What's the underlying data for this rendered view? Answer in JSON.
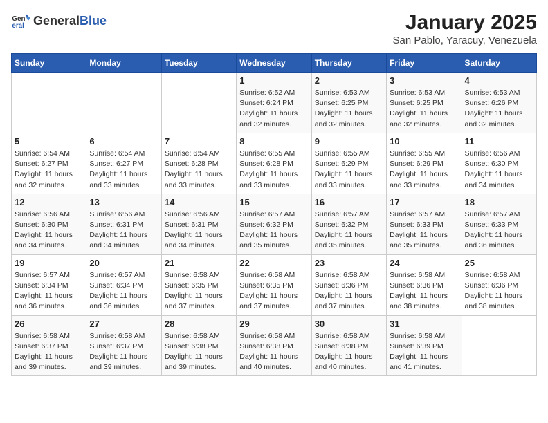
{
  "header": {
    "logo_general": "General",
    "logo_blue": "Blue",
    "title": "January 2025",
    "subtitle": "San Pablo, Yaracuy, Venezuela"
  },
  "days_of_week": [
    "Sunday",
    "Monday",
    "Tuesday",
    "Wednesday",
    "Thursday",
    "Friday",
    "Saturday"
  ],
  "weeks": [
    [
      {
        "day": "",
        "sunrise": "",
        "sunset": "",
        "daylight": ""
      },
      {
        "day": "",
        "sunrise": "",
        "sunset": "",
        "daylight": ""
      },
      {
        "day": "",
        "sunrise": "",
        "sunset": "",
        "daylight": ""
      },
      {
        "day": "1",
        "sunrise": "Sunrise: 6:52 AM",
        "sunset": "Sunset: 6:24 PM",
        "daylight": "Daylight: 11 hours and 32 minutes."
      },
      {
        "day": "2",
        "sunrise": "Sunrise: 6:53 AM",
        "sunset": "Sunset: 6:25 PM",
        "daylight": "Daylight: 11 hours and 32 minutes."
      },
      {
        "day": "3",
        "sunrise": "Sunrise: 6:53 AM",
        "sunset": "Sunset: 6:25 PM",
        "daylight": "Daylight: 11 hours and 32 minutes."
      },
      {
        "day": "4",
        "sunrise": "Sunrise: 6:53 AM",
        "sunset": "Sunset: 6:26 PM",
        "daylight": "Daylight: 11 hours and 32 minutes."
      }
    ],
    [
      {
        "day": "5",
        "sunrise": "Sunrise: 6:54 AM",
        "sunset": "Sunset: 6:27 PM",
        "daylight": "Daylight: 11 hours and 32 minutes."
      },
      {
        "day": "6",
        "sunrise": "Sunrise: 6:54 AM",
        "sunset": "Sunset: 6:27 PM",
        "daylight": "Daylight: 11 hours and 33 minutes."
      },
      {
        "day": "7",
        "sunrise": "Sunrise: 6:54 AM",
        "sunset": "Sunset: 6:28 PM",
        "daylight": "Daylight: 11 hours and 33 minutes."
      },
      {
        "day": "8",
        "sunrise": "Sunrise: 6:55 AM",
        "sunset": "Sunset: 6:28 PM",
        "daylight": "Daylight: 11 hours and 33 minutes."
      },
      {
        "day": "9",
        "sunrise": "Sunrise: 6:55 AM",
        "sunset": "Sunset: 6:29 PM",
        "daylight": "Daylight: 11 hours and 33 minutes."
      },
      {
        "day": "10",
        "sunrise": "Sunrise: 6:55 AM",
        "sunset": "Sunset: 6:29 PM",
        "daylight": "Daylight: 11 hours and 33 minutes."
      },
      {
        "day": "11",
        "sunrise": "Sunrise: 6:56 AM",
        "sunset": "Sunset: 6:30 PM",
        "daylight": "Daylight: 11 hours and 34 minutes."
      }
    ],
    [
      {
        "day": "12",
        "sunrise": "Sunrise: 6:56 AM",
        "sunset": "Sunset: 6:30 PM",
        "daylight": "Daylight: 11 hours and 34 minutes."
      },
      {
        "day": "13",
        "sunrise": "Sunrise: 6:56 AM",
        "sunset": "Sunset: 6:31 PM",
        "daylight": "Daylight: 11 hours and 34 minutes."
      },
      {
        "day": "14",
        "sunrise": "Sunrise: 6:56 AM",
        "sunset": "Sunset: 6:31 PM",
        "daylight": "Daylight: 11 hours and 34 minutes."
      },
      {
        "day": "15",
        "sunrise": "Sunrise: 6:57 AM",
        "sunset": "Sunset: 6:32 PM",
        "daylight": "Daylight: 11 hours and 35 minutes."
      },
      {
        "day": "16",
        "sunrise": "Sunrise: 6:57 AM",
        "sunset": "Sunset: 6:32 PM",
        "daylight": "Daylight: 11 hours and 35 minutes."
      },
      {
        "day": "17",
        "sunrise": "Sunrise: 6:57 AM",
        "sunset": "Sunset: 6:33 PM",
        "daylight": "Daylight: 11 hours and 35 minutes."
      },
      {
        "day": "18",
        "sunrise": "Sunrise: 6:57 AM",
        "sunset": "Sunset: 6:33 PM",
        "daylight": "Daylight: 11 hours and 36 minutes."
      }
    ],
    [
      {
        "day": "19",
        "sunrise": "Sunrise: 6:57 AM",
        "sunset": "Sunset: 6:34 PM",
        "daylight": "Daylight: 11 hours and 36 minutes."
      },
      {
        "day": "20",
        "sunrise": "Sunrise: 6:57 AM",
        "sunset": "Sunset: 6:34 PM",
        "daylight": "Daylight: 11 hours and 36 minutes."
      },
      {
        "day": "21",
        "sunrise": "Sunrise: 6:58 AM",
        "sunset": "Sunset: 6:35 PM",
        "daylight": "Daylight: 11 hours and 37 minutes."
      },
      {
        "day": "22",
        "sunrise": "Sunrise: 6:58 AM",
        "sunset": "Sunset: 6:35 PM",
        "daylight": "Daylight: 11 hours and 37 minutes."
      },
      {
        "day": "23",
        "sunrise": "Sunrise: 6:58 AM",
        "sunset": "Sunset: 6:36 PM",
        "daylight": "Daylight: 11 hours and 37 minutes."
      },
      {
        "day": "24",
        "sunrise": "Sunrise: 6:58 AM",
        "sunset": "Sunset: 6:36 PM",
        "daylight": "Daylight: 11 hours and 38 minutes."
      },
      {
        "day": "25",
        "sunrise": "Sunrise: 6:58 AM",
        "sunset": "Sunset: 6:36 PM",
        "daylight": "Daylight: 11 hours and 38 minutes."
      }
    ],
    [
      {
        "day": "26",
        "sunrise": "Sunrise: 6:58 AM",
        "sunset": "Sunset: 6:37 PM",
        "daylight": "Daylight: 11 hours and 39 minutes."
      },
      {
        "day": "27",
        "sunrise": "Sunrise: 6:58 AM",
        "sunset": "Sunset: 6:37 PM",
        "daylight": "Daylight: 11 hours and 39 minutes."
      },
      {
        "day": "28",
        "sunrise": "Sunrise: 6:58 AM",
        "sunset": "Sunset: 6:38 PM",
        "daylight": "Daylight: 11 hours and 39 minutes."
      },
      {
        "day": "29",
        "sunrise": "Sunrise: 6:58 AM",
        "sunset": "Sunset: 6:38 PM",
        "daylight": "Daylight: 11 hours and 40 minutes."
      },
      {
        "day": "30",
        "sunrise": "Sunrise: 6:58 AM",
        "sunset": "Sunset: 6:38 PM",
        "daylight": "Daylight: 11 hours and 40 minutes."
      },
      {
        "day": "31",
        "sunrise": "Sunrise: 6:58 AM",
        "sunset": "Sunset: 6:39 PM",
        "daylight": "Daylight: 11 hours and 41 minutes."
      },
      {
        "day": "",
        "sunrise": "",
        "sunset": "",
        "daylight": ""
      }
    ]
  ]
}
